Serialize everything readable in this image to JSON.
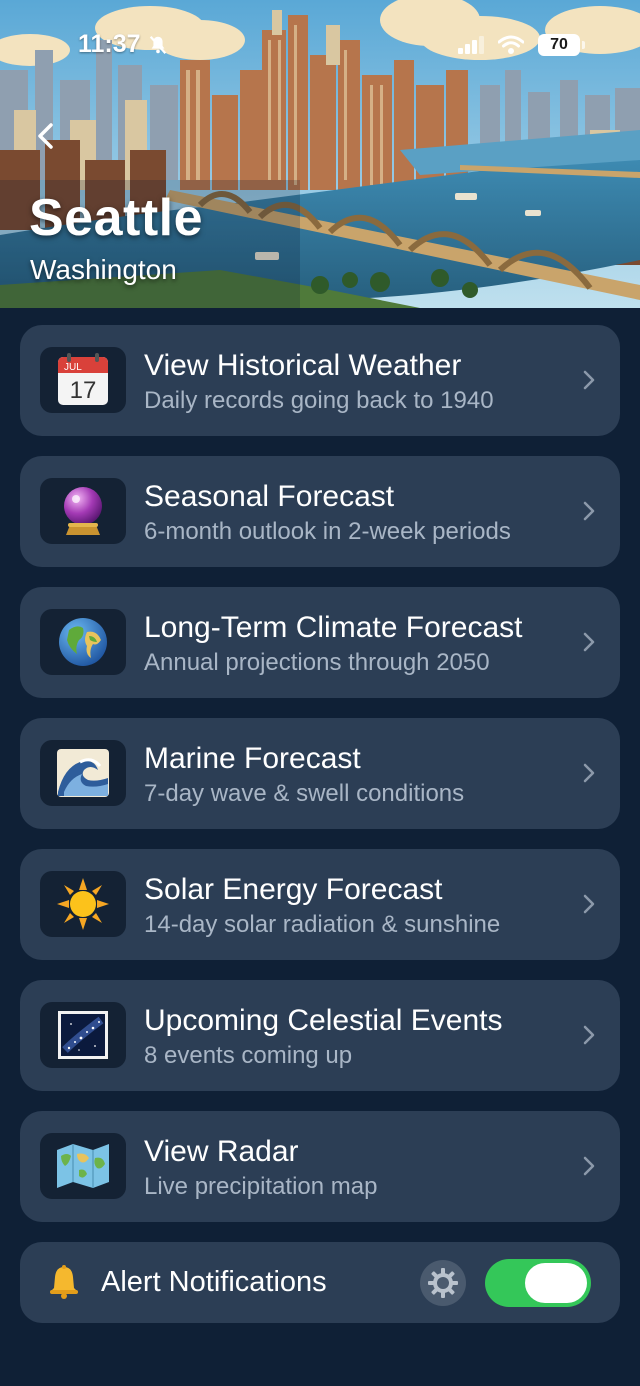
{
  "status_bar": {
    "time": "11:37",
    "battery": "70"
  },
  "header": {
    "city": "Seattle",
    "state": "Washington"
  },
  "menu": {
    "items": [
      {
        "title": "View Historical Weather",
        "subtitle": "Daily records going back to 1940",
        "icon": "calendar-icon",
        "calendar_month": "JUL",
        "calendar_day": "17"
      },
      {
        "title": "Seasonal Forecast",
        "subtitle": "6-month outlook in 2-week periods",
        "icon": "crystal-ball-icon"
      },
      {
        "title": "Long-Term Climate Forecast",
        "subtitle": "Annual projections through 2050",
        "icon": "globe-icon"
      },
      {
        "title": "Marine Forecast",
        "subtitle": "7-day wave & swell conditions",
        "icon": "wave-icon"
      },
      {
        "title": "Solar Energy Forecast",
        "subtitle": "14-day solar radiation & sunshine",
        "icon": "sun-icon"
      },
      {
        "title": "Upcoming Celestial Events",
        "subtitle": "8 events coming up",
        "icon": "night-sky-icon"
      },
      {
        "title": "View Radar",
        "subtitle": "Live precipitation map",
        "icon": "world-map-icon"
      }
    ]
  },
  "alerts": {
    "label": "Alert Notifications",
    "enabled": true
  },
  "colors": {
    "background": "#0f2036",
    "card": "#2c3e55",
    "icon_tile": "#142234",
    "toggle_on": "#34c759",
    "subtitle": "#a9b6c6"
  }
}
